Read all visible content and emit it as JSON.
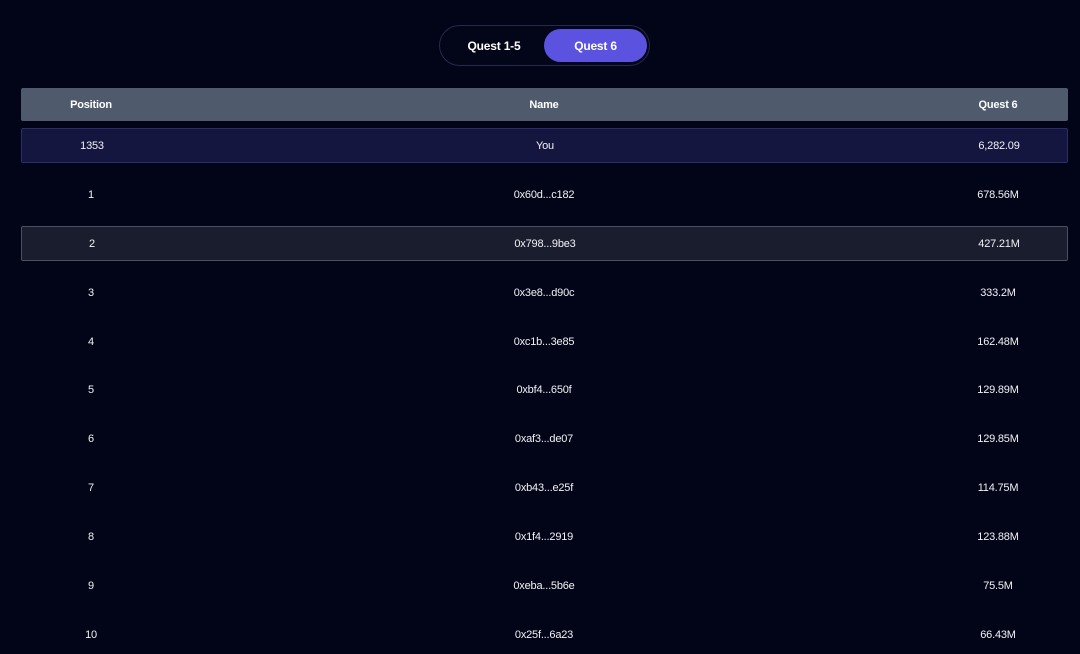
{
  "toggle": {
    "options": [
      "Quest 1-5",
      "Quest 6"
    ],
    "selected": "Quest 6"
  },
  "table": {
    "columns": [
      "Position",
      "Name",
      "Quest 6"
    ],
    "you_row": {
      "position": "1353",
      "name": "You",
      "score": "6,282.09"
    },
    "rows": [
      {
        "position": "1",
        "name": "0x60d...c182",
        "score": "678.56M"
      },
      {
        "position": "2",
        "name": "0x798...9be3",
        "score": "427.21M"
      },
      {
        "position": "3",
        "name": "0x3e8...d90c",
        "score": "333.2M"
      },
      {
        "position": "4",
        "name": "0xc1b...3e85",
        "score": "162.48M"
      },
      {
        "position": "5",
        "name": "0xbf4...650f",
        "score": "129.89M"
      },
      {
        "position": "6",
        "name": "0xaf3...de07",
        "score": "129.85M"
      },
      {
        "position": "7",
        "name": "0xb43...e25f",
        "score": "114.75M"
      },
      {
        "position": "8",
        "name": "0x1f4...2919",
        "score": "123.88M"
      },
      {
        "position": "9",
        "name": "0xeba...5b6e",
        "score": "75.5M"
      },
      {
        "position": "10",
        "name": "0x25f...6a23",
        "score": "66.43M"
      }
    ]
  }
}
